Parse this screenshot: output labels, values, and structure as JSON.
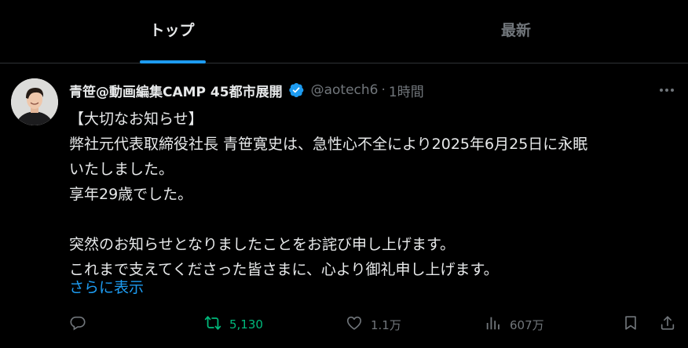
{
  "tabs": [
    {
      "label": "トップ",
      "active": true
    },
    {
      "label": "最新",
      "active": false
    }
  ],
  "tweet": {
    "display_name": "青笹@動画編集CAMP 45都市展開",
    "handle": "@aotech6",
    "separator": "·",
    "time": "1時間",
    "lines": [
      "【大切なお知らせ】",
      "弊社元代表取締役社長 青笹寛史は、急性心不全により2025年6月25日に永眠",
      "いたしました。",
      "享年29歳でした。",
      "",
      "突然のお知らせとなりましたことをお詫び申し上げます。",
      "これまで支えてくださった皆さまに、心より御礼申し上げます。"
    ],
    "show_more": "さらに表示",
    "actions": {
      "reply_count": "",
      "retweet_count": "5,130",
      "like_count": "1.1万",
      "views_count": "607万"
    }
  },
  "colors": {
    "background": "#000000",
    "text": "#e7e9ea",
    "muted": "#71767b",
    "accent": "#1d9bf0",
    "retweet_active": "#00ba7c",
    "divider": "#2f3336"
  },
  "icons": {
    "verified": "verified-badge-icon",
    "more": "more-dots-icon",
    "reply": "reply-icon",
    "retweet": "retweet-icon",
    "like": "heart-icon",
    "views": "views-bar-chart-icon",
    "bookmark": "bookmark-icon",
    "share": "share-icon"
  }
}
